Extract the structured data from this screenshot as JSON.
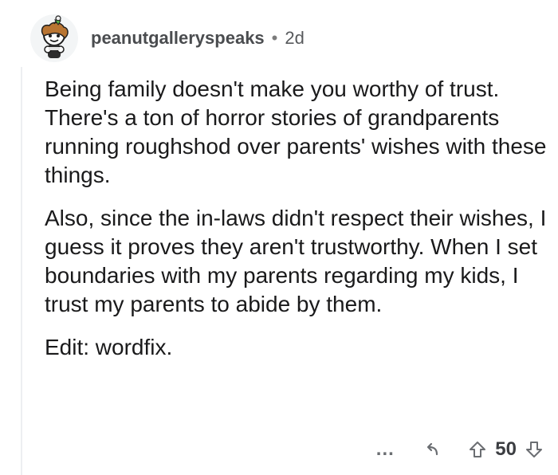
{
  "post": {
    "username": "peanutgalleryspeaks",
    "separator": "•",
    "age": "2d",
    "paragraphs": [
      "Being family doesn't make you worthy of trust.  There's a ton of horror stories of grandparents running roughshod over parents' wishes with these things.",
      "Also, since the in-laws didn't respect their wishes, I guess it proves they aren't trustworthy.  When I set boundaries with my parents regarding my kids, I trust my parents to abide by them.",
      "Edit: wordfix."
    ]
  },
  "actions": {
    "more_label": "...",
    "score": "50"
  },
  "icons": {
    "avatar": "reddit-snoo-avatar",
    "more": "more-options-icon",
    "reply": "reply-arrow-icon",
    "upvote": "upvote-arrow-icon",
    "downvote": "downvote-arrow-icon"
  },
  "colors": {
    "text": "#1a1a1b",
    "meta": "#57595c",
    "icon": "#6b6e72"
  }
}
